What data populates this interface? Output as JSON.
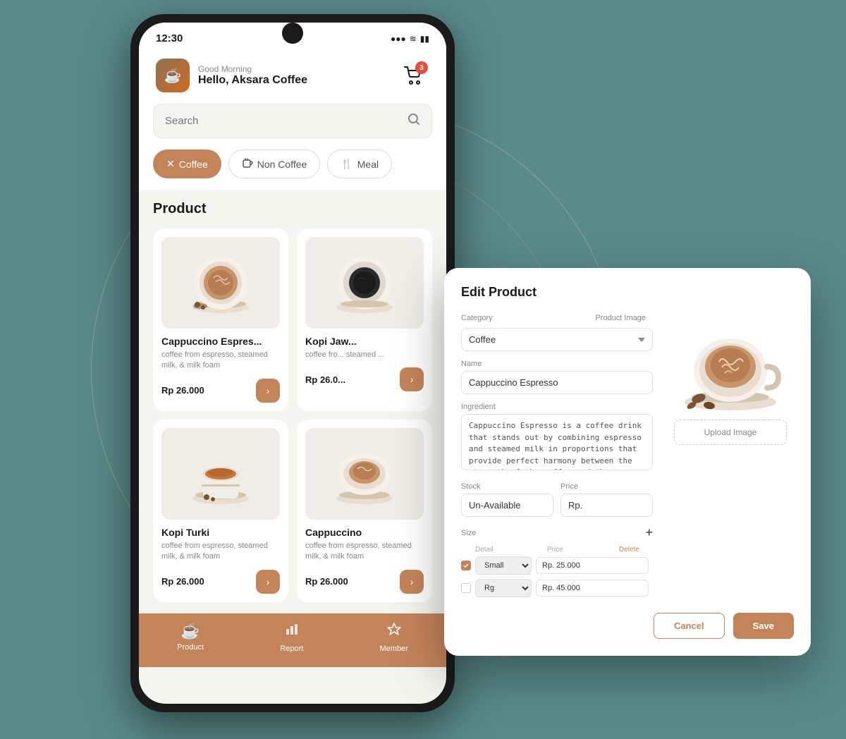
{
  "background": {
    "color": "#6b9494"
  },
  "phone": {
    "status": {
      "time": "12:30",
      "signal": "●●●",
      "wifi": "WiFi",
      "battery": "🔋"
    },
    "header": {
      "greeting": "Good Morning",
      "name": "Hello, Aksara Coffee",
      "cart_count": "3"
    },
    "search": {
      "placeholder": "Search"
    },
    "categories": [
      {
        "id": "coffee",
        "label": "Coffee",
        "active": true,
        "icon": "✕"
      },
      {
        "id": "non-coffee",
        "label": "Non Coffee",
        "active": false,
        "icon": "☕"
      },
      {
        "id": "meal",
        "label": "Meal",
        "active": false,
        "icon": "🍴"
      }
    ],
    "section_title": "Product",
    "products": [
      {
        "name": "Cappuccino Espres...",
        "desc": "coffee from espresso, steamed milk, & milk foam",
        "price": "Rp 26.000"
      },
      {
        "name": "Kopi Jaw...",
        "desc": "coffee fro... steamed ...",
        "price": "Rp 26.0..."
      },
      {
        "name": "Kopi Turki",
        "desc": "coffee from espresso, steamed milk, & milk foam",
        "price": "Rp 26.000"
      },
      {
        "name": "Cappuccino",
        "desc": "coffee from espresso, steamed milk, & milk foam",
        "price": "Rp 26.000"
      }
    ],
    "nav": [
      {
        "id": "product",
        "label": "Product",
        "icon": "☕",
        "active": true
      },
      {
        "id": "report",
        "label": "Report",
        "icon": "📊",
        "active": false
      },
      {
        "id": "member",
        "label": "Member",
        "icon": "🛡",
        "active": false
      }
    ]
  },
  "modal": {
    "title": "Edit Product",
    "category_label": "Category",
    "category_value": "Coffee",
    "product_image_label": "Product Image",
    "name_label": "Name",
    "name_value": "Cappuccino Espresso",
    "ingredient_label": "Ingredient",
    "ingredient_value": "Cappuccino Espresso is a coffee drink that stands out by combining espresso and steamed milk in proportions that provide perfect harmony between the strength of the coffee and the smoothness of the milk. The main advantage of latte lies in its balanced taste and creaminess, creating a smooth and satisfying coffee experience.",
    "stock_label": "Stock",
    "stock_value": "Un-Available",
    "price_label": "Price",
    "price_value": "Rp.",
    "size_label": "Size",
    "size_add": "+",
    "size_columns": [
      "Detail",
      "Price",
      "Delete"
    ],
    "sizes": [
      {
        "checked": true,
        "name": "Small",
        "price": "Rp. 25.000"
      },
      {
        "checked": false,
        "name": "Rg",
        "price": "Rp. 45.000"
      }
    ],
    "upload_label": "Upload Image",
    "cancel_label": "Cancel",
    "save_label": "Save"
  }
}
